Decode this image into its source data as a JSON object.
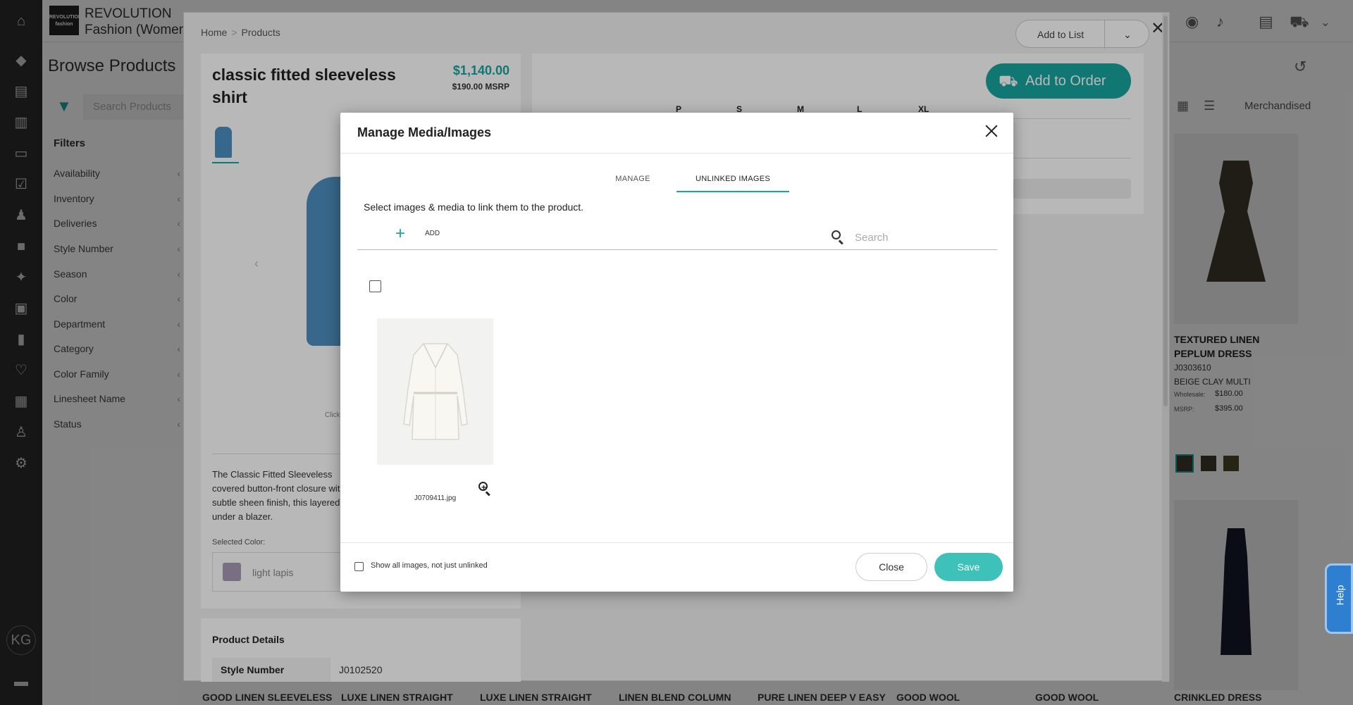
{
  "app": {
    "company_name": "REVOLUTION Fashion (Womens)",
    "logo_text": "REVOLUTION fashion",
    "user_initials": "KG",
    "page_title": "Browse Products",
    "search_placeholder": "Search Products",
    "filters_heading": "Filters",
    "filters": [
      "Availability",
      "Inventory",
      "Deliveries",
      "Style Number",
      "Season",
      "Color",
      "Department",
      "Category",
      "Color Family",
      "Linesheet Name",
      "Status"
    ],
    "sort_label": "Merchandised",
    "side_product": {
      "name": "TEXTURED LINEN PEPLUM DRESS",
      "style": "J0303610",
      "color": "BEIGE CLAY MULTI",
      "wholesale_label": "Wholesale:",
      "wholesale": "$180.00",
      "msrp_label": "MSRP:",
      "msrp": "$395.00"
    },
    "bottom_products": [
      "GOOD LINEN SLEEVELESS",
      "LUXE LINEN STRAIGHT",
      "LUXE LINEN STRAIGHT",
      "LINEN BLEND COLUMN",
      "PURE LINEN DEEP V EASY",
      "GOOD WOOL",
      "GOOD WOOL",
      "CRINKLED DRESS"
    ],
    "help_label": "Help"
  },
  "product_modal": {
    "breadcrumb": [
      "Home",
      "Products"
    ],
    "add_to_list_label": "Add to List",
    "title": "classic fitted sleeveless shirt",
    "price": "$1,140.00",
    "msrp": "$190.00 MSRP",
    "click_hint": "Click",
    "description": "The Classic Fitted Sleeveless covered button-front closure with a subtle sheen finish, this layered under a blazer.",
    "selected_color_label": "Selected Color:",
    "selected_color": "light lapis",
    "details_heading": "Product Details",
    "details": [
      {
        "key": "Style Number",
        "value": "J0102520"
      }
    ],
    "add_to_order_label": "Add to Order",
    "sizes": [
      "P",
      "S",
      "M",
      "L",
      "XL"
    ]
  },
  "media_dialog": {
    "title": "Manage Media/Images",
    "tabs": [
      {
        "label": "MANAGE",
        "active": false
      },
      {
        "label": "UNLINKED IMAGES",
        "active": true
      }
    ],
    "instructions": "Select images & media to link them to the product.",
    "add_label": "ADD",
    "search_placeholder": "Search",
    "images": [
      {
        "filename": "J0709411.jpg",
        "selected": false
      }
    ],
    "show_all_label": "Show all images, not just unlinked",
    "show_all_checked": false,
    "close_label": "Close",
    "save_label": "Save",
    "accent_color": "#18a5a0"
  }
}
